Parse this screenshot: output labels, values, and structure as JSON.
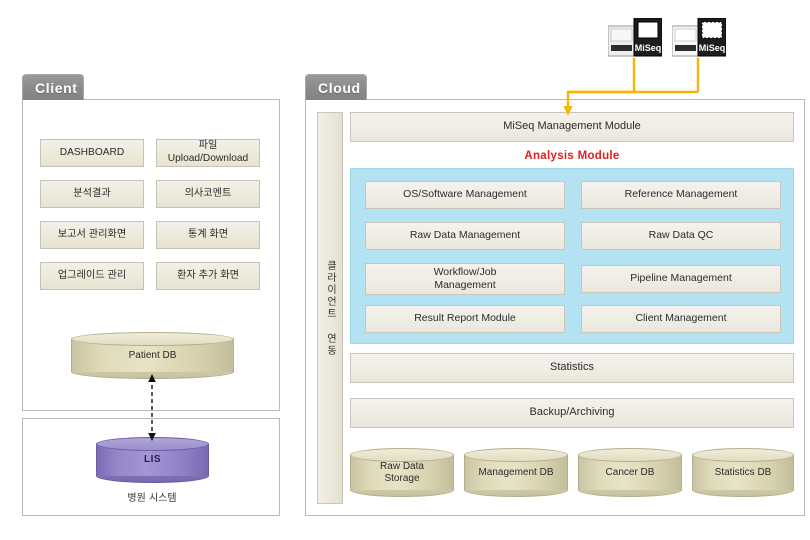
{
  "groups": {
    "client": {
      "tab_label": "Client"
    },
    "cloud": {
      "tab_label": "Cloud"
    }
  },
  "client_panel": {
    "buttons": [
      {
        "label": "DASHBOARD"
      },
      {
        "label": "파일\nUpload/Download"
      },
      {
        "label": "분석결과"
      },
      {
        "label": "의사코멘트"
      },
      {
        "label": "보고서 관리화면"
      },
      {
        "label": "통계 화면"
      },
      {
        "label": "업그레이드 관리"
      },
      {
        "label": "환자 추가 화면"
      }
    ],
    "database": {
      "label": "Patient DB"
    }
  },
  "hospital_panel": {
    "database": {
      "label": "LIS"
    },
    "caption": "병원 시스템"
  },
  "cloud_panel": {
    "sidebar_label": "클라이언트 연동",
    "management_module": {
      "label": "MiSeq Management Module"
    },
    "analysis_module": {
      "title": "Analysis Module",
      "title_color": "#e02020",
      "background": "#b3e2f2",
      "items": [
        {
          "label": "OS/Software Management"
        },
        {
          "label": "Reference Management"
        },
        {
          "label": "Raw Data Management"
        },
        {
          "label": "Raw Data QC"
        },
        {
          "label": "Workflow/Job\nManagement"
        },
        {
          "label": "Pipeline Management"
        },
        {
          "label": "Result Report Module"
        },
        {
          "label": "Client Management"
        }
      ]
    },
    "bars": [
      {
        "label": "Statistics"
      },
      {
        "label": "Backup/Archiving"
      }
    ],
    "databases": [
      {
        "label": "Raw Data\nStorage"
      },
      {
        "label": "Management DB"
      },
      {
        "label": "Cancer DB"
      },
      {
        "label": "Statistics DB"
      }
    ]
  },
  "devices": [
    {
      "label": "MiSeq"
    },
    {
      "label": "MiSeq"
    }
  ],
  "connectors": {
    "device_link_color": "#f2b705",
    "db_link_color": "#111111"
  }
}
